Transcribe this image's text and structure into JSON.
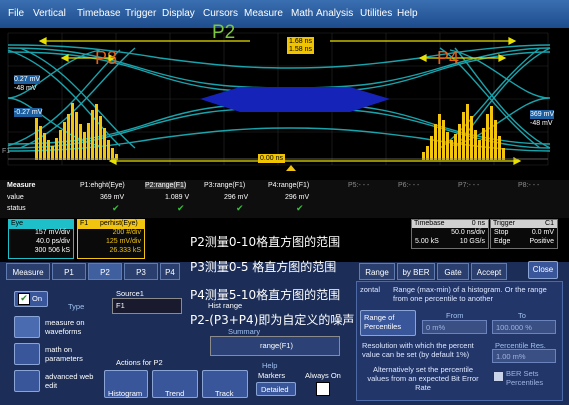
{
  "menu": [
    "File",
    "Vertical",
    "Timebase",
    "Trigger",
    "Display",
    "Cursors",
    "Measure",
    "Math",
    "Analysis",
    "Utilities",
    "Help"
  ],
  "scope": {
    "labels": {
      "p2": "P2",
      "p3": "P3",
      "p4": "P4",
      "top_marker_1": "1.68 ns",
      "top_marker_2": "1.58 ns",
      "left_marker_1": "0.27 mV",
      "left_marker_2": "-48 mV",
      "left_marker_3": "-0.27 mV",
      "right_marker_1": "369 mV",
      "right_marker_2": "-48 mV",
      "bottom_marker": "0.00 ns",
      "f1": "F1"
    },
    "colors": {
      "eye": "#1fbfc9",
      "hist": "#f1c40f",
      "mask": "#1523b8",
      "bracket": "#e8e000"
    }
  },
  "measure": {
    "headers": [
      "Measure",
      "P1:ehght(Eye)",
      "P2:range(F1)",
      "P3:range(F1)",
      "P4:range(F1)",
      "P5:- - -",
      "P6:- - -",
      "P7:- - -",
      "P8:- - -"
    ],
    "row_value_label": "value",
    "row_status_label": "status",
    "values": [
      "369 mV",
      "1.089 V",
      "296 mV",
      "296 mV"
    ]
  },
  "channels": {
    "eye": {
      "name": "Eye",
      "v1": "157 mV/div",
      "v2": "40.0 ps/div",
      "v3": "300 506 kS"
    },
    "f1": {
      "name": "F1",
      "sub": "perhist(Eye)",
      "v1": "200 #/div",
      "v2": "125 mV/div",
      "v3": "26.333 kS"
    }
  },
  "timebase": {
    "label": "Timebase",
    "t0": "0 ns",
    "row1": "50.0 ns/div",
    "row2a": "5.00 kS",
    "row2b": "10 GS/s"
  },
  "trigger": {
    "label": "Trigger",
    "c1": "C1",
    "r1a": "Stop",
    "r1b": "0.0 mV",
    "r2a": "Edge",
    "r2b": "Positive"
  },
  "annotations": [
    "P2测量0-10格直方图的范围",
    "P3测量0-5 格直方图的范围",
    "P4测量5-10格直方图的范围",
    "P2-(P3+P4)即为自定义的噪声"
  ],
  "tabs": [
    "Measure",
    "P1",
    "P2",
    "P3",
    "P4",
    "",
    "",
    "Range",
    "by BER",
    "Gate",
    "Accept"
  ],
  "close": "Close",
  "panel": {
    "on": "On",
    "type": "Type",
    "type_items": [
      "measure on waveforms",
      "math on parameters",
      "advanced web edit"
    ],
    "source1_label": "Source1",
    "source1_value": "F1",
    "measure_name": "Hist range",
    "summary_label": "Summary",
    "summary_value": "range(F1)",
    "actions_label": "Actions for P2",
    "actions": [
      "Histogram",
      "Trend",
      "Track"
    ],
    "help": "Help",
    "markers": "Markers",
    "detailed": "Detailed",
    "always_on": "Always On",
    "desc": "Range (max-min) of a histogram. Or the range from one percentile to another",
    "desc_prefix": "zontal",
    "range_of_percentiles": "Range of Percentiles",
    "from_label": "From",
    "from_value": "0 m%",
    "to_label": "To",
    "to_value": "100.000 %",
    "resolution_text": "Resolution with which the percent value can be set (by default 1%)",
    "percentile_res_label": "Percentile Res.",
    "percentile_res_value": "1.00 m%",
    "alt_text": "Alternatively set the percentile values from an expected Bit Error Rate",
    "ber_sets": "BER Sets Percentiles"
  }
}
